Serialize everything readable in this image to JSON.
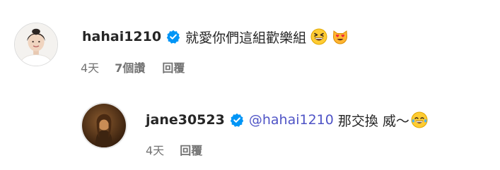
{
  "comments": [
    {
      "username": "hahai1210",
      "verified": true,
      "text": "就愛你們這組歡樂組",
      "emojis": [
        "grinning-squinting-face",
        "smiling-cat-heart-eyes"
      ],
      "time": "4天",
      "likes": "7個讚",
      "reply_label": "回覆"
    },
    {
      "username": "jane30523",
      "verified": true,
      "mention": "@hahai1210",
      "text": "那交換 威～",
      "emojis": [
        "face-with-tears-of-joy"
      ],
      "time": "4天",
      "reply_label": "回覆"
    }
  ],
  "colors": {
    "username": "#262626",
    "meta": "#737373",
    "mention": "#4f54c6",
    "verified_badge": "#0095f6"
  }
}
